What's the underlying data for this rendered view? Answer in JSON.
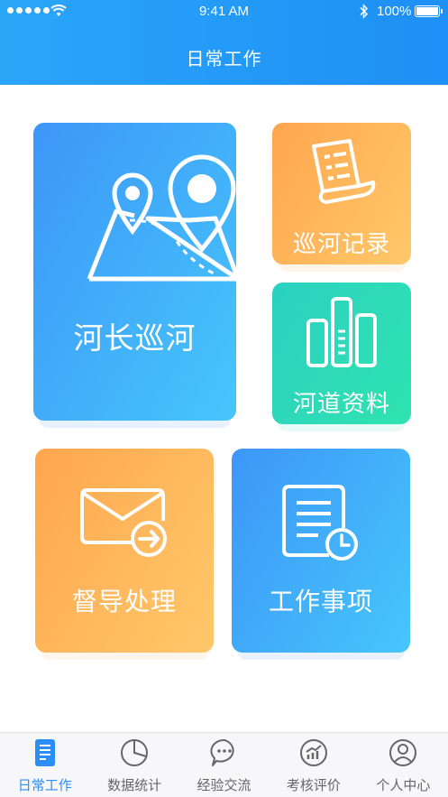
{
  "status_bar": {
    "time": "9:41 AM",
    "battery": "100%"
  },
  "header": {
    "title": "日常工作"
  },
  "cards": [
    {
      "label": "河长巡河",
      "icon": "map-pin-icon"
    },
    {
      "label": "巡河记录",
      "icon": "document-scroll-icon"
    },
    {
      "label": "河道资料",
      "icon": "bar-chart-icon"
    },
    {
      "label": "督导处理",
      "icon": "mail-forward-icon"
    },
    {
      "label": "工作事项",
      "icon": "document-clock-icon"
    }
  ],
  "tabs": [
    {
      "label": "日常工作",
      "icon": "document-icon",
      "active": true
    },
    {
      "label": "数据统计",
      "icon": "pie-chart-icon",
      "active": false
    },
    {
      "label": "经验交流",
      "icon": "chat-bubble-icon",
      "active": false
    },
    {
      "label": "考核评价",
      "icon": "trend-chart-icon",
      "active": false
    },
    {
      "label": "个人中心",
      "icon": "user-icon",
      "active": false
    }
  ],
  "colors": {
    "brand_blue": "#2a8ef6",
    "orange": "#ffb05a",
    "green": "#2fd9b8"
  }
}
